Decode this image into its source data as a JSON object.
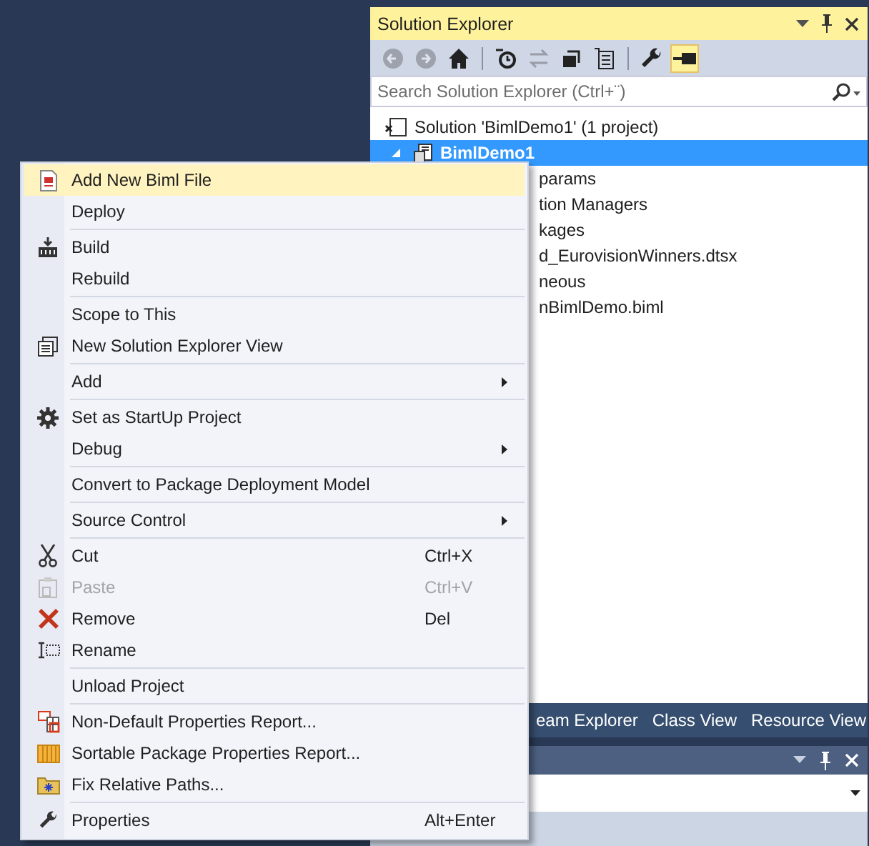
{
  "solution_explorer": {
    "title": "Solution Explorer",
    "search": {
      "placeholder": "Search Solution Explorer (Ctrl+¨)"
    },
    "toolbar": [
      {
        "disabled": true,
        "on": false
      },
      {
        "disabled": true,
        "on": false
      },
      {
        "disabled": false,
        "on": false
      },
      {
        "disabled": false,
        "on": false
      },
      {
        "disabled": true,
        "on": false
      },
      {
        "disabled": false,
        "on": false
      },
      {
        "disabled": false,
        "on": false
      },
      {
        "disabled": false,
        "on": false
      },
      {
        "disabled": false,
        "on": true
      }
    ],
    "tree": [
      {
        "label": "Solution 'BimlDemo1' (1 project)",
        "selected": false,
        "children": [
          {
            "label": "BimlDemo1",
            "selected": true,
            "expanded": true,
            "children": [
              {
                "label": "params",
                "selected": false
              },
              {
                "label": "tion Managers",
                "selected": false
              },
              {
                "label": "kages",
                "selected": false
              },
              {
                "label": "d_EurovisionWinners.dtsx",
                "selected": false
              },
              {
                "label": "neous",
                "selected": false
              },
              {
                "label": "nBimlDemo.biml",
                "selected": false
              }
            ]
          }
        ]
      }
    ],
    "tabs": [
      {
        "label": "eam Explorer",
        "selected": false
      },
      {
        "label": "Class View",
        "selected": false
      },
      {
        "label": "Resource View",
        "selected": false
      }
    ]
  },
  "context_menu": [
    {
      "kind": "item",
      "label": "Add New Biml File",
      "selected": true,
      "disabled": false
    },
    {
      "kind": "item",
      "label": "Deploy",
      "selected": false,
      "disabled": false
    },
    {
      "kind": "separator"
    },
    {
      "kind": "item",
      "label": "Build",
      "selected": false,
      "disabled": false
    },
    {
      "kind": "item",
      "label": "Rebuild",
      "selected": false,
      "disabled": false
    },
    {
      "kind": "separator"
    },
    {
      "kind": "item",
      "label": "Scope to This",
      "selected": false,
      "disabled": false
    },
    {
      "kind": "item",
      "label": "New Solution Explorer View",
      "selected": false,
      "disabled": false
    },
    {
      "kind": "separator"
    },
    {
      "kind": "item",
      "label": "Add",
      "selected": false,
      "disabled": false,
      "submenu": true
    },
    {
      "kind": "separator"
    },
    {
      "kind": "item",
      "label": "Set as StartUp Project",
      "selected": false,
      "disabled": false
    },
    {
      "kind": "item",
      "label": "Debug",
      "selected": false,
      "disabled": false,
      "submenu": true
    },
    {
      "kind": "separator"
    },
    {
      "kind": "item",
      "label": "Convert to Package Deployment Model",
      "selected": false,
      "disabled": false
    },
    {
      "kind": "separator"
    },
    {
      "kind": "item",
      "label": "Source Control",
      "selected": false,
      "disabled": false,
      "submenu": true
    },
    {
      "kind": "separator"
    },
    {
      "kind": "item",
      "label": "Cut",
      "shortcut": "Ctrl+X",
      "selected": false,
      "disabled": false
    },
    {
      "kind": "item",
      "label": "Paste",
      "shortcut": "Ctrl+V",
      "selected": false,
      "disabled": true
    },
    {
      "kind": "item",
      "label": "Remove",
      "shortcut": "Del",
      "selected": false,
      "disabled": false
    },
    {
      "kind": "item",
      "label": "Rename",
      "selected": false,
      "disabled": false
    },
    {
      "kind": "separator"
    },
    {
      "kind": "item",
      "label": "Unload Project",
      "selected": false,
      "disabled": false
    },
    {
      "kind": "separator"
    },
    {
      "kind": "item",
      "label": "Non-Default Properties Report...",
      "selected": false,
      "disabled": false
    },
    {
      "kind": "item",
      "label": "Sortable Package Properties Report...",
      "selected": false,
      "disabled": false
    },
    {
      "kind": "item",
      "label": "Fix Relative Paths...",
      "selected": false,
      "disabled": false
    },
    {
      "kind": "separator"
    },
    {
      "kind": "item",
      "label": "Properties",
      "shortcut": "Alt+Enter",
      "selected": false,
      "disabled": false
    }
  ]
}
